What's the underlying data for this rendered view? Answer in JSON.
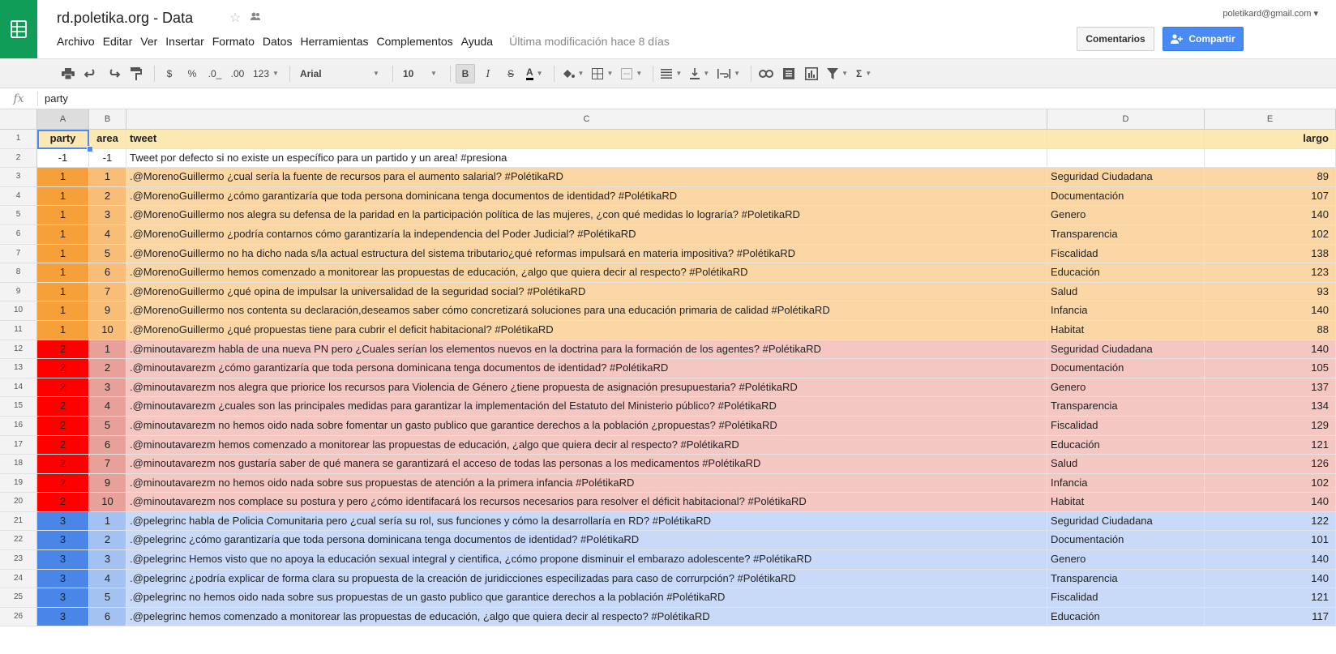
{
  "app": {
    "doc_title": "rd.poletika.org - Data",
    "account": "poletikard@gmail.com",
    "account_caret": "▾",
    "comments_label": "Comentarios",
    "share_label": "Compartir",
    "menus": [
      "Archivo",
      "Editar",
      "Ver",
      "Insertar",
      "Formato",
      "Datos",
      "Herramientas",
      "Complementos",
      "Ayuda"
    ],
    "last_modified": "Última modificación hace 8 días"
  },
  "toolbar": {
    "currency": "$",
    "percent": "%",
    "dec_less": ".0_",
    "dec_more": ".00",
    "more_formats": "123",
    "font": "Arial",
    "font_size": "10",
    "bold": "B",
    "italic": "I",
    "strike": "S",
    "text_color": "A",
    "sum": "Σ"
  },
  "formula_bar": {
    "fx": "fx",
    "value": "party"
  },
  "columns": [
    "A",
    "B",
    "C",
    "D",
    "E"
  ],
  "header_row": {
    "a": "party",
    "b": "area",
    "c": "tweet",
    "d": "",
    "e": "largo"
  },
  "colors": {
    "header_bg": "#fce8b2",
    "party1_a": "#f6a03a",
    "party1_rest": "#fbd7a6",
    "party1_b": "#f8be78",
    "party2_a": "#fe0000",
    "party2_rest": "#f4c7c3",
    "party2_b": "#e8a09a",
    "party3_a": "#4a86e8",
    "party3_rest": "#c9daf8",
    "party3_b": "#a3c2f2"
  },
  "rows": [
    {
      "n": "2",
      "a": "-1",
      "b": "-1",
      "c": "Tweet por defecto si no existe un específico para un partido y un area! #presiona",
      "d": "",
      "e": ""
    },
    {
      "n": "3",
      "a": "1",
      "b": "1",
      "c": ".@MorenoGuillermo ¿cual sería la fuente de recursos para el aumento salarial? #PolétikaRD",
      "d": "Seguridad Ciudadana",
      "e": "89"
    },
    {
      "n": "4",
      "a": "1",
      "b": "2",
      "c": ".@MorenoGuillermo ¿cómo garantizaría que toda persona dominicana tenga documentos de identidad? #PolétikaRD",
      "d": "Documentación",
      "e": "107"
    },
    {
      "n": "5",
      "a": "1",
      "b": "3",
      "c": ".@MorenoGuillermo nos alegra su defensa de la paridad en la participación política de las mujeres, ¿con qué medidas lo lograría? #PoletikaRD",
      "d": "Genero",
      "e": "140"
    },
    {
      "n": "6",
      "a": "1",
      "b": "4",
      "c": ".@MorenoGuillermo ¿podría contarnos cómo garantizaría la independencia del Poder Judicial? #PolétikaRD",
      "d": "Transparencia",
      "e": "102"
    },
    {
      "n": "7",
      "a": "1",
      "b": "5",
      "c": ".@MorenoGuillermo no ha dicho nada s/la actual estructura del sistema tributario¿qué reformas impulsará en materia impositiva? #PolétikaRD",
      "d": "Fiscalidad",
      "e": "138"
    },
    {
      "n": "8",
      "a": "1",
      "b": "6",
      "c": ".@MorenoGuillermo hemos comenzado a monitorear las propuestas de educación, ¿algo que quiera decir al respecto? #PolétikaRD",
      "d": "Educación",
      "e": "123"
    },
    {
      "n": "9",
      "a": "1",
      "b": "7",
      "c": ".@MorenoGuillermo ¿qué opina de impulsar la universalidad de la seguridad social? #PolétikaRD",
      "d": "Salud",
      "e": "93"
    },
    {
      "n": "10",
      "a": "1",
      "b": "9",
      "c": ".@MorenoGuillermo nos contenta su declaración,deseamos saber cómo concretizará soluciones para una educación primaria de calidad #PolétikaRD",
      "d": "Infancia",
      "e": "140"
    },
    {
      "n": "11",
      "a": "1",
      "b": "10",
      "c": ".@MorenoGuillermo ¿qué propuestas tiene para cubrir el deficit habitacional? #PolétikaRD",
      "d": "Habitat",
      "e": "88"
    },
    {
      "n": "12",
      "a": "2",
      "b": "1",
      "c": ".@minoutavarezm habla de una nueva PN pero ¿Cuales serían los elementos nuevos en la doctrina para la formación de los agentes? #PolétikaRD",
      "d": "Seguridad Ciudadana",
      "e": "140"
    },
    {
      "n": "13",
      "a": "2",
      "b": "2",
      "c": ".@minoutavarezm ¿cómo garantizaría que toda persona dominicana tenga documentos de identidad? #PolétikaRD",
      "d": "Documentación",
      "e": "105"
    },
    {
      "n": "14",
      "a": "2",
      "b": "3",
      "c": ".@minoutavarezm nos alegra que priorice los recursos para Violencia de Género ¿tiene propuesta de asignación presupuestaria?  #PolétikaRD",
      "d": "Genero",
      "e": "137"
    },
    {
      "n": "15",
      "a": "2",
      "b": "4",
      "c": ".@minoutavarezm ¿cuales son las principales medidas para garantizar la implementación del Estatuto del Ministerio público? #PolétikaRD",
      "d": "Transparencia",
      "e": "134"
    },
    {
      "n": "16",
      "a": "2",
      "b": "5",
      "c": ".@minoutavarezm no hemos oido nada sobre fomentar un gasto publico que garantice derechos a la población ¿propuestas? #PolétikaRD",
      "d": "Fiscalidad",
      "e": "129"
    },
    {
      "n": "17",
      "a": "2",
      "b": "6",
      "c": ".@minoutavarezm hemos comenzado a monitorear las propuestas de educación, ¿algo que quiera decir al respecto? #PolétikaRD",
      "d": "Educación",
      "e": "121"
    },
    {
      "n": "18",
      "a": "2",
      "b": "7",
      "c": ".@minoutavarezm nos gustaría saber de qué manera se garantizará el acceso de todas las personas a los medicamentos #PolétikaRD",
      "d": "Salud",
      "e": "126"
    },
    {
      "n": "19",
      "a": "2",
      "b": "9",
      "c": ".@minoutavarezm  no hemos oido nada sobre sus propuestas de atención a la primera infancia #PolétikaRD",
      "d": "Infancia",
      "e": "102"
    },
    {
      "n": "20",
      "a": "2",
      "b": "10",
      "c": ".@minoutavarezm nos complace su postura y pero ¿cómo identifacará los recursos necesarios para resolver el déficit habitacional? #PolétikaRD",
      "d": "Habitat",
      "e": "140"
    },
    {
      "n": "21",
      "a": "3",
      "b": "1",
      "c": ".@pelegrinc habla de Policia Comunitaria pero ¿cual sería su rol, sus funciones y cómo la desarrollaría en RD? #PolétikaRD",
      "d": "Seguridad Ciudadana",
      "e": "122"
    },
    {
      "n": "22",
      "a": "3",
      "b": "2",
      "c": ".@pelegrinc ¿cómo garantizaría que toda persona dominicana tenga documentos de identidad? #PolétikaRD",
      "d": "Documentación",
      "e": "101"
    },
    {
      "n": "23",
      "a": "3",
      "b": "3",
      "c": ".@pelegrinc Hemos visto que no apoya la educación sexual integral y cientifica, ¿cómo propone disminuir el embarazo adolescente? #PolétikaRD",
      "d": "Genero",
      "e": "140"
    },
    {
      "n": "24",
      "a": "3",
      "b": "4",
      "c": ".@pelegrinc ¿podría explicar de forma clara su propuesta de la creación de juridicciones especilizadas para caso de corrurpción? #PolétikaRD",
      "d": "Transparencia",
      "e": "140"
    },
    {
      "n": "25",
      "a": "3",
      "b": "5",
      "c": ".@pelegrinc no hemos oido nada sobre sus propuestas de un gasto publico que garantice derechos a la población #PolétikaRD",
      "d": "Fiscalidad",
      "e": "121"
    },
    {
      "n": "26",
      "a": "3",
      "b": "6",
      "c": ".@pelegrinc hemos comenzado a monitorear las propuestas de educación, ¿algo que quiera decir al respecto? #PolétikaRD",
      "d": "Educación",
      "e": "117"
    }
  ]
}
